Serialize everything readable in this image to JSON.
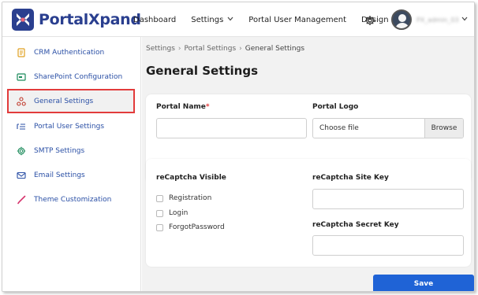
{
  "app": {
    "brand": "PortalXpand",
    "brand_color": "#2a3f8f",
    "accent_color": "#1f63d6"
  },
  "header": {
    "nav": [
      {
        "label": "Dashboard",
        "has_dropdown": false
      },
      {
        "label": "Settings",
        "has_dropdown": true
      },
      {
        "label": "Portal User Management",
        "has_dropdown": false
      },
      {
        "label": "Design",
        "has_dropdown": true
      }
    ],
    "gear_icon": "gear-icon",
    "user_name": "PX_admin_03",
    "user_icon": "avatar-icon"
  },
  "sidebar": {
    "items": [
      {
        "label": "CRM Authentication",
        "icon": "document-icon",
        "active": false
      },
      {
        "label": "SharePoint Configuration",
        "icon": "sharepoint-icon",
        "active": false
      },
      {
        "label": "General Settings",
        "icon": "nodes-icon",
        "active": true
      },
      {
        "label": "Portal User Settings",
        "icon": "user-list-icon",
        "active": false
      },
      {
        "label": "SMTP Settings",
        "icon": "gear-icon",
        "active": false
      },
      {
        "label": "Email Settings",
        "icon": "envelope-icon",
        "active": false
      },
      {
        "label": "Theme Customization",
        "icon": "brush-icon",
        "active": false
      }
    ]
  },
  "breadcrumb": [
    "Settings",
    "Portal Settings",
    "General Settings"
  ],
  "page_title": "General Settings",
  "form": {
    "portal_name_label": "Portal Name",
    "portal_name_required": "*",
    "portal_name_value": "",
    "portal_logo_label": "Portal Logo",
    "file_placeholder": "Choose file",
    "browse_label": "Browse",
    "recaptcha_visible_label": "reCaptcha Visible",
    "recaptcha_options": [
      {
        "label": "Registration",
        "checked": false
      },
      {
        "label": "Login",
        "checked": false
      },
      {
        "label": "ForgotPassword",
        "checked": false
      }
    ],
    "site_key_label": "reCaptcha Site Key",
    "site_key_value": "",
    "secret_key_label": "reCaptcha Secret Key",
    "secret_key_value": "",
    "save_label": "Save"
  }
}
